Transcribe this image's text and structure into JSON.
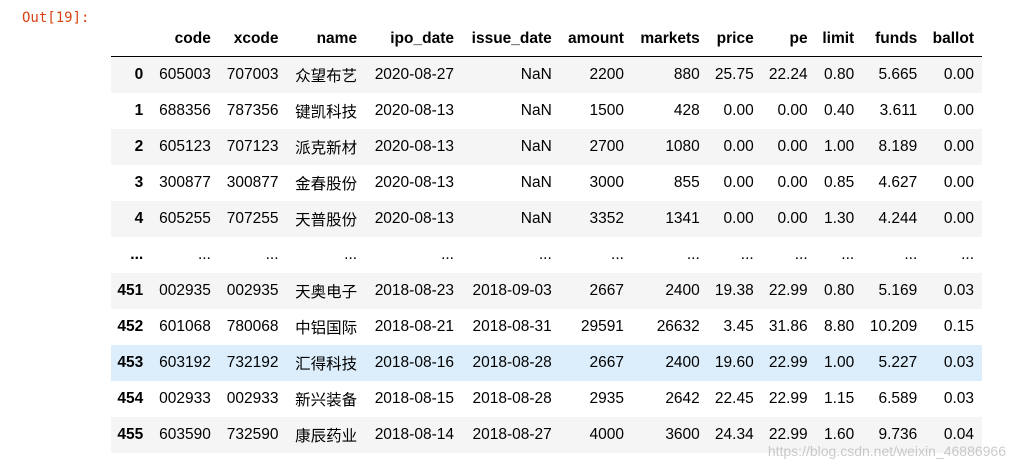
{
  "cell": {
    "prompt": "Out[19]:"
  },
  "table": {
    "columns": [
      "",
      "code",
      "xcode",
      "name",
      "ipo_date",
      "issue_date",
      "amount",
      "markets",
      "price",
      "pe",
      "limit",
      "funds",
      "ballot"
    ],
    "rows": [
      [
        "0",
        "605003",
        "707003",
        "众望布艺",
        "2020-08-27",
        "NaN",
        "2200",
        "880",
        "25.75",
        "22.24",
        "0.80",
        "5.665",
        "0.00"
      ],
      [
        "1",
        "688356",
        "787356",
        "键凯科技",
        "2020-08-13",
        "NaN",
        "1500",
        "428",
        "0.00",
        "0.00",
        "0.40",
        "3.611",
        "0.00"
      ],
      [
        "2",
        "605123",
        "707123",
        "派克新材",
        "2020-08-13",
        "NaN",
        "2700",
        "1080",
        "0.00",
        "0.00",
        "1.00",
        "8.189",
        "0.00"
      ],
      [
        "3",
        "300877",
        "300877",
        "金春股份",
        "2020-08-13",
        "NaN",
        "3000",
        "855",
        "0.00",
        "0.00",
        "0.85",
        "4.627",
        "0.00"
      ],
      [
        "4",
        "605255",
        "707255",
        "天普股份",
        "2020-08-13",
        "NaN",
        "3352",
        "1341",
        "0.00",
        "0.00",
        "1.30",
        "4.244",
        "0.00"
      ],
      [
        "...",
        "...",
        "...",
        "...",
        "...",
        "...",
        "...",
        "...",
        "...",
        "...",
        "...",
        "...",
        "..."
      ],
      [
        "451",
        "002935",
        "002935",
        "天奥电子",
        "2018-08-23",
        "2018-09-03",
        "2667",
        "2400",
        "19.38",
        "22.99",
        "0.80",
        "5.169",
        "0.03"
      ],
      [
        "452",
        "601068",
        "780068",
        "中铝国际",
        "2018-08-21",
        "2018-08-31",
        "29591",
        "26632",
        "3.45",
        "31.86",
        "8.80",
        "10.209",
        "0.15"
      ],
      [
        "453",
        "603192",
        "732192",
        "汇得科技",
        "2018-08-16",
        "2018-08-28",
        "2667",
        "2400",
        "19.60",
        "22.99",
        "1.00",
        "5.227",
        "0.03"
      ],
      [
        "454",
        "002933",
        "002933",
        "新兴装备",
        "2018-08-15",
        "2018-08-28",
        "2935",
        "2642",
        "22.45",
        "22.99",
        "1.15",
        "6.589",
        "0.03"
      ],
      [
        "455",
        "603590",
        "732590",
        "康辰药业",
        "2018-08-14",
        "2018-08-27",
        "4000",
        "3600",
        "24.34",
        "22.99",
        "1.60",
        "9.736",
        "0.04"
      ]
    ],
    "hover_row_index": 8
  },
  "watermark": "https://blog.csdn.net/weixin_46886966",
  "colors": {
    "prompt": "#d84315",
    "row_stripe": "#f5f5f5",
    "row_hover": "#dceefb"
  }
}
